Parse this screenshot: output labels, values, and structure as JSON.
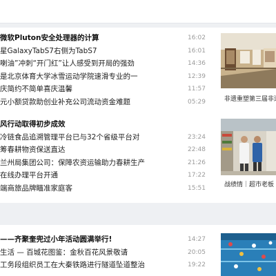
{
  "section1": {
    "items": [
      {
        "title": "微软Pluton安全处理器的计算",
        "time": "16:02",
        "headline": true
      },
      {
        "title": "星GalaxyTabS7右侧为TabS7",
        "time": "16:01",
        "headline": false
      },
      {
        "title": "喇油”冲刺“开门红”让人感受到开局的强劲",
        "time": "14:36",
        "headline": false
      },
      {
        "title": "是北京体育大学冰雪运动学院速滑专业的一",
        "time": "12:39",
        "headline": false
      },
      {
        "title": "庆简约不简单喜庆温馨",
        "time": "11:57",
        "headline": false
      },
      {
        "title": "元小额贷款助创业补充公司流动资金难题",
        "time": "05:29",
        "headline": false
      }
    ],
    "image_caption": "非遗重塑第三届非遗"
  },
  "section2": {
    "items": [
      {
        "title": "风行动取得初步成效",
        "time": "",
        "headline": true
      },
      {
        "title": "冷链食品追溯管理平台已与32个省级平台对",
        "time": "23:24",
        "headline": false
      },
      {
        "title": "筹春耕物资保送直达",
        "time": "22:48",
        "headline": false
      },
      {
        "title": "兰州局集团公司：保障农资运输助力春耕生产",
        "time": "21:26",
        "headline": false
      },
      {
        "title": "在线办理平台开通",
        "time": "17:22",
        "headline": false
      },
      {
        "title": "端商旅品牌瞄准家庭客",
        "time": "15:51",
        "headline": false
      }
    ],
    "image_caption": "战绩情｜超市老板"
  },
  "section3": {
    "items": [
      {
        "title": "——齐聚奎兜过小年活动圆满举行!",
        "time": "14:27",
        "headline": true
      },
      {
        "title": "生活 — 百城花图鉴：金秋百花风景敬请",
        "time": "20:05",
        "headline": false
      },
      {
        "title": "工务段组织员工在大秦铁路进行隧道坠道整治",
        "time": "19:22",
        "headline": false
      }
    ]
  }
}
